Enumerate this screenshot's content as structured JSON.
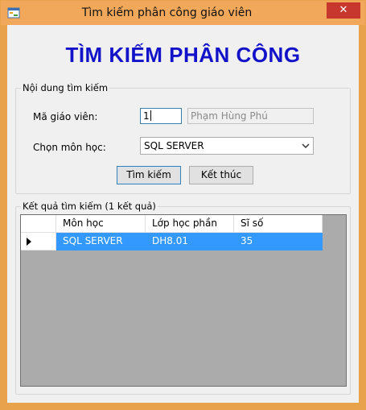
{
  "window": {
    "title": "Tìm kiếm phân công giáo viên",
    "close_glyph": "✕"
  },
  "form": {
    "heading": "TÌM KIẾM PHÂN CÔNG"
  },
  "search": {
    "legend": "Nội dung tìm kiếm",
    "teacher_id_label": "Mã giáo viên:",
    "teacher_id_value": "1",
    "teacher_name_value": "Phạm Hùng Phú",
    "subject_label": "Chọn môn học:",
    "subject_selected": "SQL SERVER",
    "search_button": "Tìm kiếm",
    "exit_button": "Kết thúc"
  },
  "results": {
    "legend": "Kết quả tìm kiếm (1 kết quả)",
    "columns": [
      "Môn học",
      "Lớp học phần",
      "Sĩ số"
    ],
    "rows": [
      [
        "SQL SERVER",
        "DH8.01",
        "35"
      ]
    ]
  },
  "icons": {
    "app": "app-form-icon",
    "close": "close-icon",
    "dropdown": "chevron-down-icon",
    "row_pointer": "row-pointer-icon"
  },
  "colors": {
    "title_bar": "#f2a85a",
    "close_button": "#c8372d",
    "heading": "#1212c9",
    "selection": "#3399ff",
    "grid_background": "#ababab"
  }
}
